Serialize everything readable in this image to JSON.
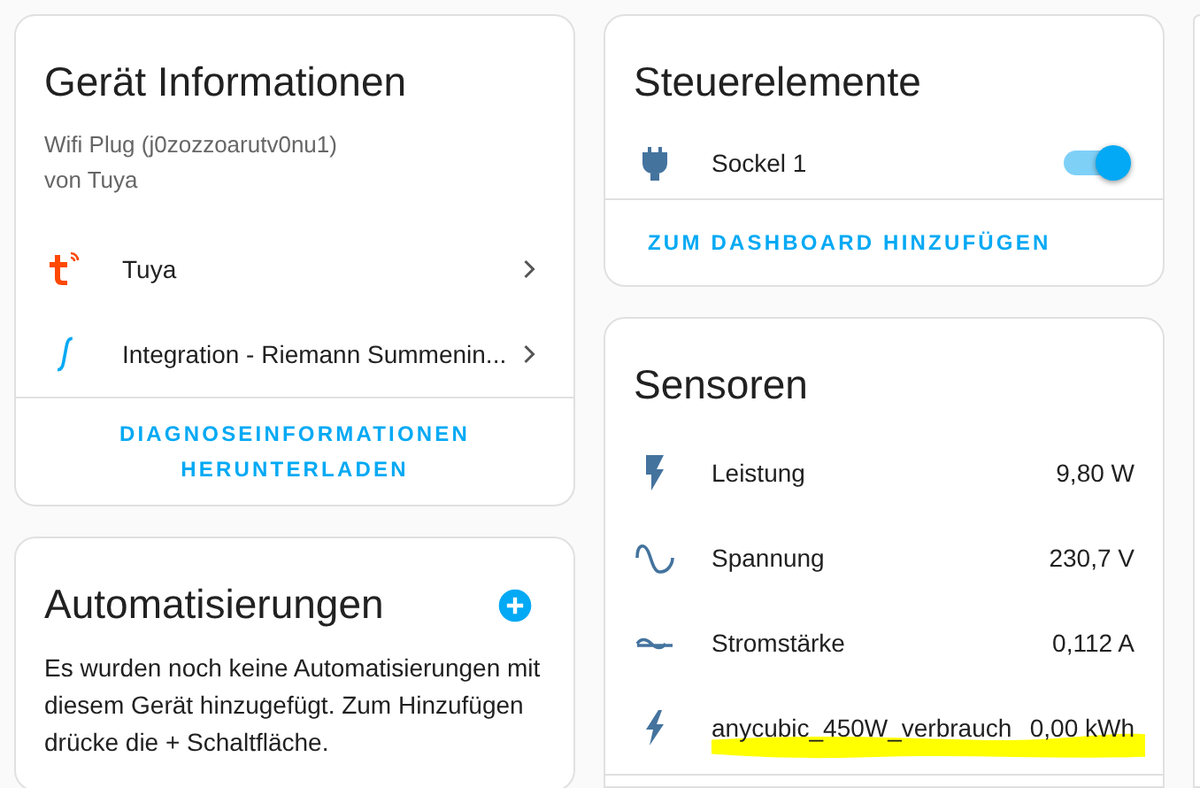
{
  "device_info": {
    "title": "Gerät Informationen",
    "model": "Wifi Plug (j0zozzoarutv0nu1)",
    "manufacturer": "von Tuya",
    "links": [
      {
        "kind": "tuya",
        "label": "Tuya"
      },
      {
        "kind": "integral",
        "label": "Integration - Riemann Summenin..."
      }
    ],
    "action": "DIAGNOSEINFORMATIONEN HERUNTERLADEN"
  },
  "automations": {
    "title": "Automatisierungen",
    "text": "Es wurden noch keine Automatisierungen mit diesem Gerät hinzugefügt. Zum Hinzufügen drücke die + Schaltfläche."
  },
  "controls": {
    "title": "Steuerelemente",
    "items": [
      {
        "label": "Sockel 1",
        "on": true
      }
    ],
    "action": "ZUM DASHBOARD HINZUFÜGEN"
  },
  "sensors": {
    "title": "Sensoren",
    "items": [
      {
        "kind": "power",
        "label": "Leistung",
        "value": "9,80 W",
        "highlighted": false
      },
      {
        "kind": "voltage",
        "label": "Spannung",
        "value": "230,7 V",
        "highlighted": false
      },
      {
        "kind": "current",
        "label": "Stromstärke",
        "value": "0,112 A",
        "highlighted": false
      },
      {
        "kind": "energy",
        "label": "anycubic_450W_verbrauch",
        "value": "0,00 kWh",
        "highlighted": true
      }
    ]
  }
}
